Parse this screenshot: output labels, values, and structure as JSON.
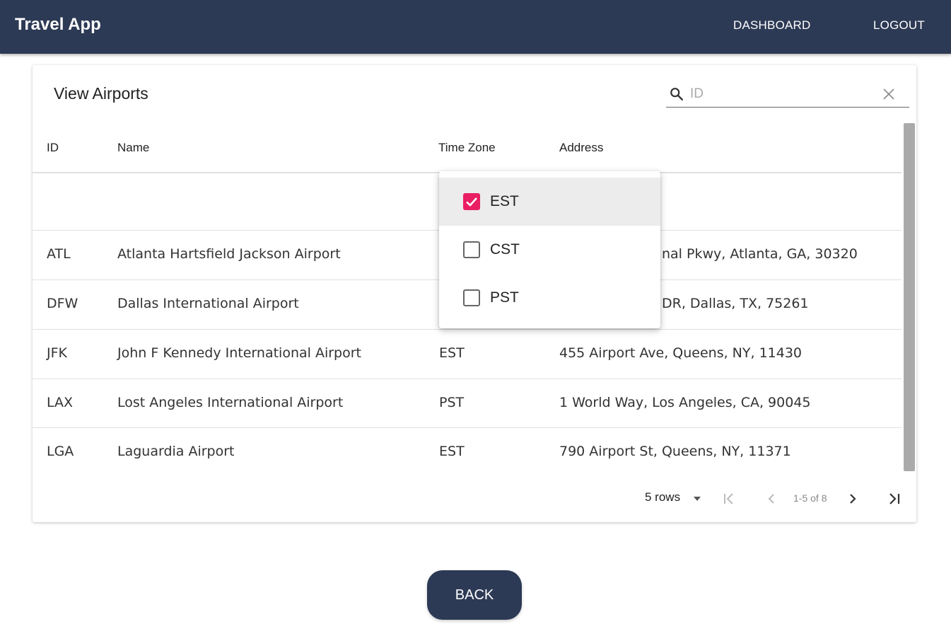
{
  "app": {
    "title": "Travel App",
    "nav": {
      "dashboard": "DASHBOARD",
      "logout": "LOGOUT"
    },
    "colors": {
      "primary": "#2d3a55",
      "accent": "#e91e63"
    }
  },
  "card": {
    "title": "View Airports",
    "search": {
      "placeholder": "ID",
      "value": ""
    },
    "columns": {
      "id": "ID",
      "name": "Name",
      "time_zone": "Time Zone",
      "address": "Address"
    },
    "rows": [
      {
        "id": "ATL",
        "name": "Atlanta Hartsfield Jackson Airport",
        "time_zone": "",
        "address": "nal Pkwy, Atlanta, GA, 30320"
      },
      {
        "id": "DFW",
        "name": "Dallas International Airport",
        "time_zone": "",
        "address": "DR, Dallas, TX, 75261"
      },
      {
        "id": "JFK",
        "name": "John F Kennedy International Airport",
        "time_zone": "EST",
        "address": "455 Airport Ave, Queens, NY, 11430"
      },
      {
        "id": "LAX",
        "name": "Lost Angeles International Airport",
        "time_zone": "PST",
        "address": "1 World Way, Los Angeles, CA, 90045"
      },
      {
        "id": "LGA",
        "name": "Laguardia Airport",
        "time_zone": "EST",
        "address": "790 Airport St, Queens, NY, 11371"
      }
    ],
    "pagination": {
      "rows_per_page": "5 rows",
      "range": "1-5 of 8"
    }
  },
  "timezone_filter": {
    "options": [
      {
        "label": "EST",
        "checked": true
      },
      {
        "label": "CST",
        "checked": false
      },
      {
        "label": "PST",
        "checked": false
      }
    ]
  },
  "back_button": {
    "label": "BACK"
  }
}
